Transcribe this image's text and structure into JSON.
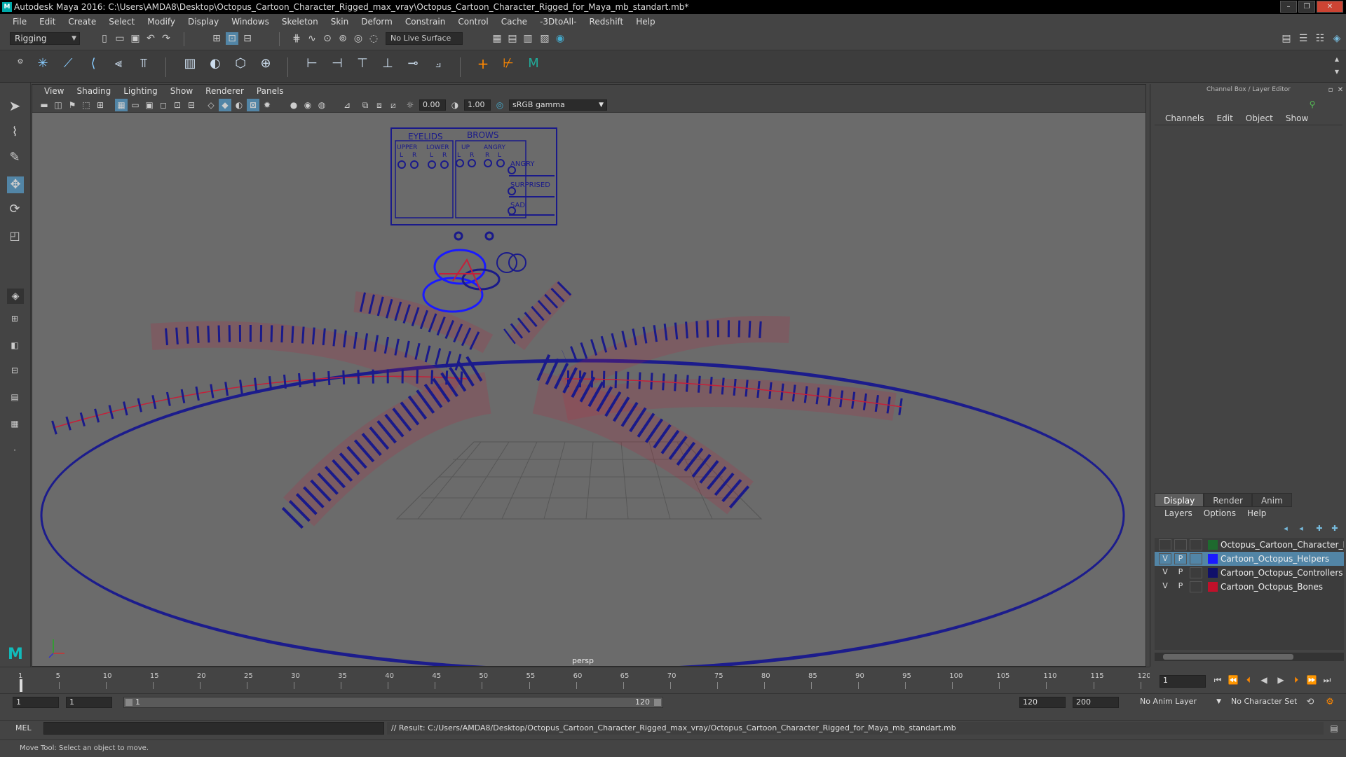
{
  "app": {
    "title": "Autodesk Maya 2016: C:\\Users\\AMDA8\\Desktop\\Octopus_Cartoon_Character_Rigged_max_vray\\Octopus_Cartoon_Character_Rigged_for_Maya_mb_standart.mb*",
    "logo_letter": "M"
  },
  "menus": [
    "File",
    "Edit",
    "Create",
    "Select",
    "Modify",
    "Display",
    "Windows",
    "Skeleton",
    "Skin",
    "Deform",
    "Constrain",
    "Control",
    "Cache",
    "-3DtoAll-",
    "Redshift",
    "Help"
  ],
  "toolbar": {
    "mode": "Rigging",
    "live_surface": "No Live Surface"
  },
  "viewport": {
    "menus": [
      "View",
      "Shading",
      "Lighting",
      "Show",
      "Renderer",
      "Panels"
    ],
    "exposure": "0.00",
    "gamma": "1.00",
    "color_space": "sRGB gamma",
    "camera_label": "persp",
    "facial_panel": {
      "eyelids": "EYELIDS",
      "brows": "BROWS",
      "upper": "UPPER",
      "lower": "LOWER",
      "up": "UP",
      "angry_col": "ANGRY",
      "l": "L",
      "r": "R",
      "angry": "ANGRY",
      "surprised": "SURPRISED",
      "sad": "SAD"
    }
  },
  "channel_box": {
    "title": "Channel Box / Layer Editor",
    "menus": [
      "Channels",
      "Edit",
      "Object",
      "Show"
    ]
  },
  "layer_editor": {
    "tabs": [
      "Display",
      "Render",
      "Anim"
    ],
    "active_tab": "Display",
    "menus": [
      "Layers",
      "Options",
      "Help"
    ],
    "layers": [
      {
        "v": "",
        "p": "",
        "name": "Octopus_Cartoon_Character_Rigged",
        "color": "#1e6a2e",
        "selected": false
      },
      {
        "v": "V",
        "p": "P",
        "name": "Cartoon_Octopus_Helpers",
        "color": "#1a1aff",
        "selected": true
      },
      {
        "v": "V",
        "p": "P",
        "name": "Cartoon_Octopus_Controllers",
        "color": "#10106a",
        "selected": false
      },
      {
        "v": "V",
        "p": "P",
        "name": "Cartoon_Octopus_Bones",
        "color": "#c0102a",
        "selected": false
      }
    ]
  },
  "timeline": {
    "ticks": [
      "1",
      "5",
      "10",
      "15",
      "20",
      "25",
      "30",
      "35",
      "40",
      "45",
      "50",
      "55",
      "60",
      "65",
      "70",
      "75",
      "80",
      "85",
      "90",
      "95",
      "100",
      "105",
      "110",
      "115",
      "120"
    ],
    "current_frame": "1"
  },
  "range": {
    "start": "1",
    "playback_start": "1",
    "slider_start": "1",
    "slider_end": "120",
    "playback_end": "120",
    "end": "200",
    "anim_layer": "No Anim Layer",
    "character_set": "No Character Set"
  },
  "command": {
    "lang": "MEL",
    "result": "// Result: C:/Users/AMDA8/Desktop/Octopus_Cartoon_Character_Rigged_max_vray/Octopus_Cartoon_Character_Rigged_for_Maya_mb_standart.mb"
  },
  "status": "Move Tool: Select an object to move."
}
